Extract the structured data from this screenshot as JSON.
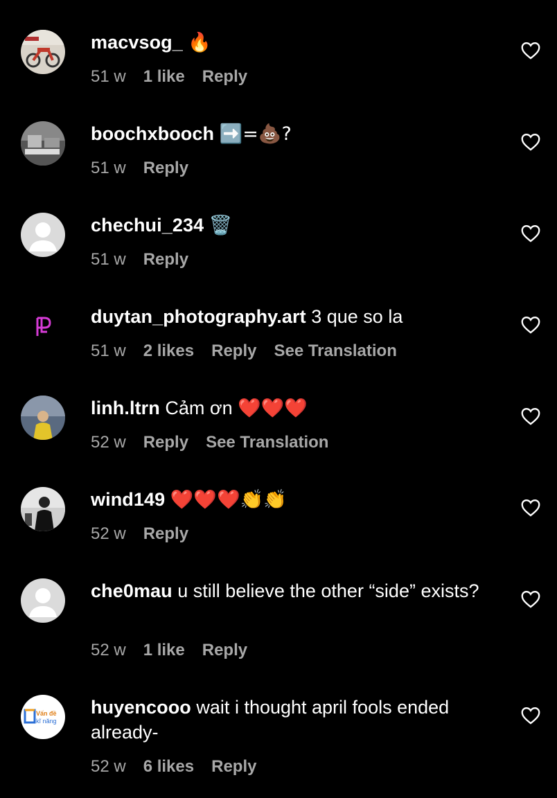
{
  "comments": [
    {
      "username": "macvsog_",
      "text": "",
      "emoji": "🔥",
      "age": "51 w",
      "likes": "1 like",
      "reply": "Reply",
      "translate": ""
    },
    {
      "username": "boochxbooch",
      "text": "",
      "emoji": "➡️=💩?",
      "age": "51 w",
      "likes": "",
      "reply": "Reply",
      "translate": ""
    },
    {
      "username": "chechui_234",
      "text": "",
      "emoji": "🗑️",
      "age": "51 w",
      "likes": "",
      "reply": "Reply",
      "translate": ""
    },
    {
      "username": "duytan_photography.art",
      "text": "3 que so la",
      "emoji": "",
      "age": "51 w",
      "likes": "2 likes",
      "reply": "Reply",
      "translate": "See Translation"
    },
    {
      "username": "linh.ltrn",
      "text": "Cảm ơn",
      "emoji": "❤️❤️❤️",
      "age": "52 w",
      "likes": "",
      "reply": "Reply",
      "translate": "See Translation"
    },
    {
      "username": "wind149",
      "text": "",
      "emoji": "❤️❤️❤️👏👏",
      "age": "52 w",
      "likes": "",
      "reply": "Reply",
      "translate": ""
    },
    {
      "username": "che0mau",
      "text": "u still believe the other “side” exists?",
      "emoji": "",
      "age": "52 w",
      "likes": "1 like",
      "reply": "Reply",
      "translate": ""
    },
    {
      "username": "huyencooo",
      "text": "wait i thought april fools ended already-",
      "emoji": "",
      "age": "52 w",
      "likes": "6 likes",
      "reply": "Reply",
      "translate": ""
    }
  ],
  "avatar_logo_text": {
    "line1": "Vấn đề",
    "line2": "kĩ năng"
  },
  "colors": {
    "background": "#000000",
    "primary_text": "#ffffff",
    "secondary_text": "#a8a8a8",
    "heart_stroke": "#ffffff"
  },
  "icons": {
    "like": "heart-outline-icon",
    "default_avatar": "person-icon"
  }
}
